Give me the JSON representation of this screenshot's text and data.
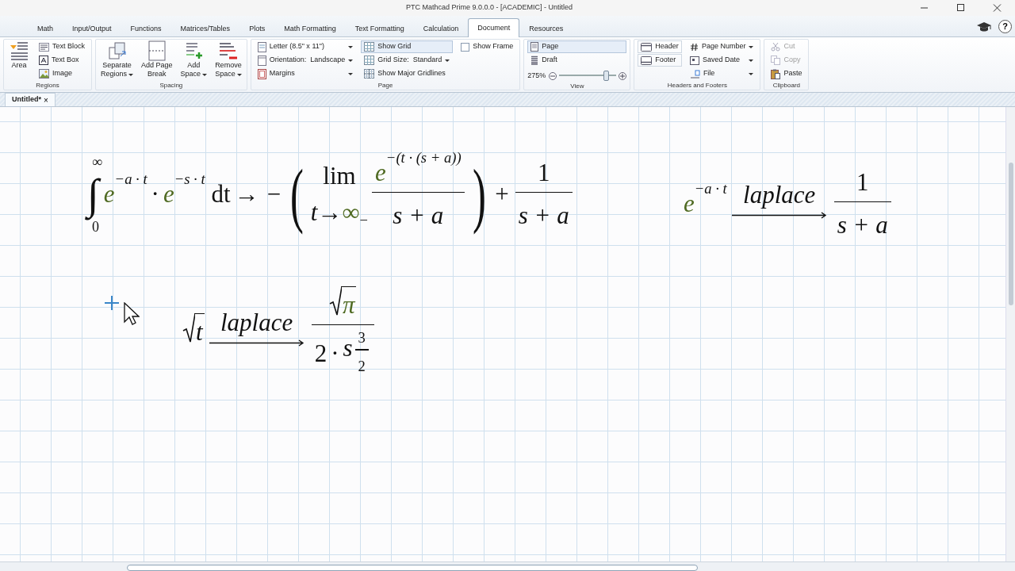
{
  "window": {
    "title": "PTC Mathcad Prime 9.0.0.0 - [ACADEMIC] - Untitled"
  },
  "tabs": [
    {
      "label": "Math",
      "selected": false
    },
    {
      "label": "Input/Output",
      "selected": false
    },
    {
      "label": "Functions",
      "selected": false
    },
    {
      "label": "Matrices/Tables",
      "selected": false
    },
    {
      "label": "Plots",
      "selected": false
    },
    {
      "label": "Math Formatting",
      "selected": false
    },
    {
      "label": "Text Formatting",
      "selected": false
    },
    {
      "label": "Calculation",
      "selected": false
    },
    {
      "label": "Document",
      "selected": true
    },
    {
      "label": "Resources",
      "selected": false
    }
  ],
  "help": "?",
  "ribbon": {
    "groups": [
      {
        "title": "Regions",
        "columns": [
          [
            {
              "kind": "large",
              "label": "Area"
            }
          ],
          [
            {
              "kind": "button",
              "label": "Text Block"
            },
            {
              "kind": "button",
              "label": "Text Box"
            },
            {
              "kind": "button",
              "label": "Image"
            }
          ]
        ]
      },
      {
        "title": "Spacing",
        "columns": [
          [
            {
              "kind": "large",
              "label": "Separate\nRegions",
              "dropdown": true
            }
          ],
          [
            {
              "kind": "large",
              "label": "Add Page\nBreak"
            }
          ],
          [
            {
              "kind": "large",
              "label": "Add\nSpace",
              "dropdown": true
            }
          ],
          [
            {
              "kind": "large",
              "label": "Remove\nSpace",
              "dropdown": true
            }
          ]
        ]
      },
      {
        "title": "Page",
        "columns": [
          [
            {
              "kind": "button",
              "label": "Letter (8.5\" x 11\")",
              "dropdown": true
            },
            {
              "kind": "button",
              "label": "Orientation:  Landscape",
              "dropdown": true
            },
            {
              "kind": "button",
              "label": "Margins",
              "dropdown": true
            }
          ],
          [
            {
              "kind": "toggle",
              "label": "Show Grid",
              "checked": true
            },
            {
              "kind": "button",
              "label": "Grid Size:  Standard",
              "dropdown": true
            },
            {
              "kind": "toggle",
              "label": "Show Major Gridlines",
              "checked": false
            }
          ],
          [
            {
              "kind": "checkbox",
              "label": "Show Frame",
              "checked": false
            }
          ]
        ]
      },
      {
        "title": "View",
        "columns": [
          [
            {
              "kind": "radio",
              "label": "Page",
              "selected": true
            },
            {
              "kind": "radio",
              "label": "Draft",
              "selected": false
            },
            {
              "kind": "zoom",
              "reading": "275%",
              "level": 0.82
            }
          ]
        ]
      },
      {
        "title": "Headers and Footers",
        "columns": [
          [
            {
              "kind": "pane",
              "label": "Header"
            },
            {
              "kind": "pane",
              "label": "Footer"
            }
          ],
          [
            {
              "kind": "button",
              "label": "Page Number",
              "dropdown": true
            },
            {
              "kind": "button",
              "label": "Saved Date",
              "dropdown": true
            },
            {
              "kind": "button",
              "label": "File",
              "dropdown": true
            }
          ]
        ]
      },
      {
        "title": "Clipboard",
        "columns": [
          [
            {
              "kind": "button",
              "label": "Cut",
              "disabled": true
            },
            {
              "kind": "button",
              "label": "Copy",
              "disabled": true
            },
            {
              "kind": "button",
              "label": "Paste",
              "disabled": false
            }
          ]
        ]
      }
    ]
  },
  "documents": [
    {
      "title": "Untitled*",
      "close": "×"
    }
  ],
  "worksheet": {
    "regions": [
      {
        "items": [
          {
            "kind": "integral",
            "sign": "∫",
            "lower": "0",
            "upper": "∞",
            "body": [
              {
                "kind": "power",
                "base": "e",
                "constant": true,
                "exponent": [
                  {
                    "kind": "var",
                    "text": "−a · t"
                  }
                ]
              },
              {
                "kind": "op",
                "text": "·"
              },
              {
                "kind": "power",
                "base": "e",
                "constant": true,
                "exponent": [
                  {
                    "kind": "var",
                    "text": "−s · t"
                  }
                ]
              }
            ],
            "differential": "dt"
          },
          {
            "kind": "op",
            "text": "→"
          },
          {
            "kind": "op",
            "text": "−"
          },
          {
            "kind": "paren",
            "open": "(",
            "close": ")",
            "content": [
              {
                "kind": "limit",
                "word": "lim",
                "variable": "t",
                "arrow": "→",
                "target": "∞",
                "target_constant": true,
                "side": "−"
              },
              {
                "kind": "fraction",
                "numerator": [
                  {
                    "kind": "power",
                    "base": "e",
                    "constant": true,
                    "exponent": [
                      {
                        "kind": "var",
                        "text": "−(t · (s + a))"
                      }
                    ]
                  }
                ],
                "denominator": [
                  {
                    "kind": "var",
                    "text": "s + a"
                  }
                ]
              }
            ]
          },
          {
            "kind": "op",
            "text": "+"
          },
          {
            "kind": "fraction",
            "numerator": [
              {
                "kind": "num",
                "text": "1"
              }
            ],
            "denominator": [
              {
                "kind": "var",
                "text": "s + a"
              }
            ]
          }
        ]
      },
      {
        "items": [
          {
            "kind": "power",
            "base": "e",
            "constant": true,
            "exponent": [
              {
                "kind": "var",
                "text": "−a · t"
              }
            ]
          },
          {
            "kind": "laplace",
            "keyword": "laplace"
          },
          {
            "kind": "fraction",
            "numerator": [
              {
                "kind": "num",
                "text": "1"
              }
            ],
            "denominator": [
              {
                "kind": "var",
                "text": "s + a"
              }
            ]
          }
        ]
      },
      {
        "items": [
          {
            "kind": "sqrt",
            "content": [
              {
                "kind": "var",
                "text": "t"
              }
            ]
          },
          {
            "kind": "laplace",
            "keyword": "laplace"
          },
          {
            "kind": "fraction",
            "numerator": [
              {
                "kind": "sqrt",
                "content": [
                  {
                    "kind": "var",
                    "text": "π",
                    "constant": true
                  }
                ]
              }
            ],
            "denominator": [
              {
                "kind": "num",
                "text": "2"
              },
              {
                "kind": "op",
                "text": "·"
              },
              {
                "kind": "power",
                "base": "s",
                "constant": false,
                "exponent": [
                  {
                    "kind": "fraction",
                    "numerator": [
                      {
                        "kind": "num",
                        "text": "3"
                      }
                    ],
                    "denominator": [
                      {
                        "kind": "num",
                        "text": "2"
                      }
                    ]
                  }
                ]
              }
            ]
          }
        ]
      }
    ]
  }
}
